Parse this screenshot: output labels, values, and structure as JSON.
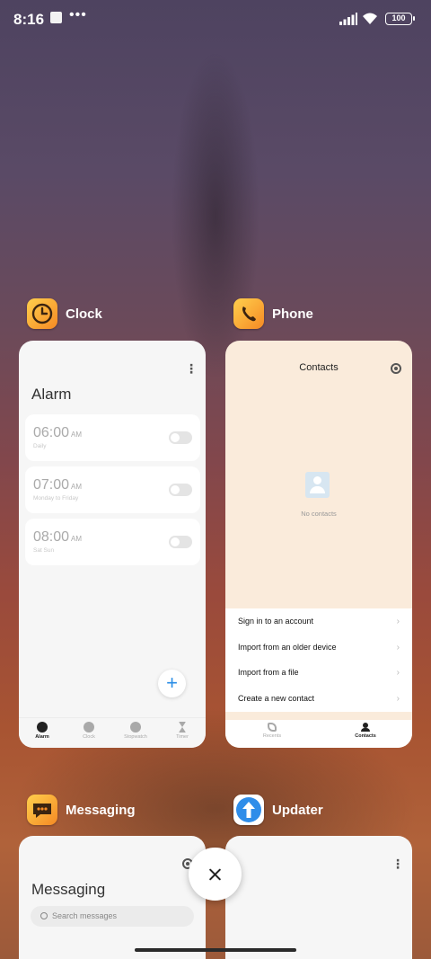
{
  "status_bar": {
    "time": "8:16",
    "battery": "100"
  },
  "apps": {
    "clock": {
      "title": "Clock",
      "heading": "Alarm",
      "alarms": [
        {
          "time": "06:00",
          "ampm": "AM",
          "repeat": "Daily",
          "enabled": false
        },
        {
          "time": "07:00",
          "ampm": "AM",
          "repeat": "Monday to Friday",
          "enabled": false
        },
        {
          "time": "08:00",
          "ampm": "AM",
          "repeat": "Sat Sun",
          "enabled": false
        }
      ],
      "add_label": "+",
      "nav": [
        "Alarm",
        "Clock",
        "Stopwatch",
        "Timer"
      ]
    },
    "phone": {
      "title": "Phone",
      "header": "Contacts",
      "empty_text": "No contacts",
      "actions": [
        "Sign in to an account",
        "Import from an older device",
        "Import from a file",
        "Create a new contact"
      ],
      "nav": [
        "Recents",
        "Contacts"
      ]
    },
    "messaging": {
      "title": "Messaging",
      "heading": "Messaging",
      "search_placeholder": "Search messages"
    },
    "updater": {
      "title": "Updater"
    }
  },
  "colors": {
    "accent": "#2a8de6",
    "icon_orange": "#f59a2b"
  }
}
